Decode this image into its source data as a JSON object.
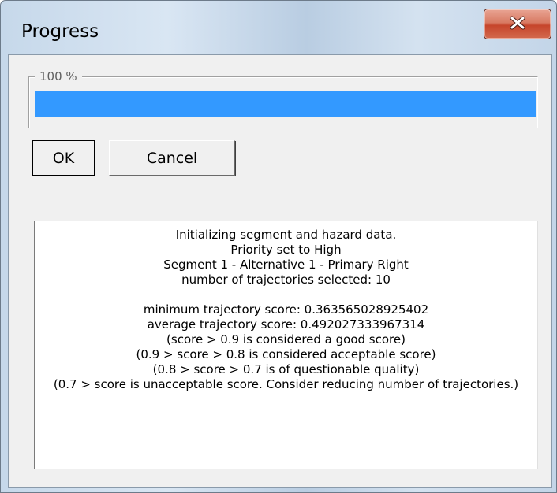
{
  "window": {
    "title": "Progress",
    "close_icon": "close-icon"
  },
  "progress": {
    "label": "100 %",
    "fraction": 1.0,
    "fill_color": "#3399ff"
  },
  "buttons": {
    "ok_label": "OK",
    "cancel_label": "Cancel"
  },
  "log": {
    "lines_top": [
      "Initializing segment and hazard data.",
      "Priority set to High",
      "Segment 1 - Alternative 1 - Primary Right",
      "number of trajectories selected: 10"
    ],
    "lines_bottom": [
      "minimum trajectory score: 0.363565028925402",
      "average trajectory score: 0.492027333967314",
      "(score > 0.9 is considered a good score)",
      "(0.9 > score > 0.8 is considered acceptable score)",
      "(0.8 > score > 0.7 is of questionable quality)",
      "(0.7 > score is unacceptable score. Consider reducing number of trajectories.)"
    ]
  }
}
